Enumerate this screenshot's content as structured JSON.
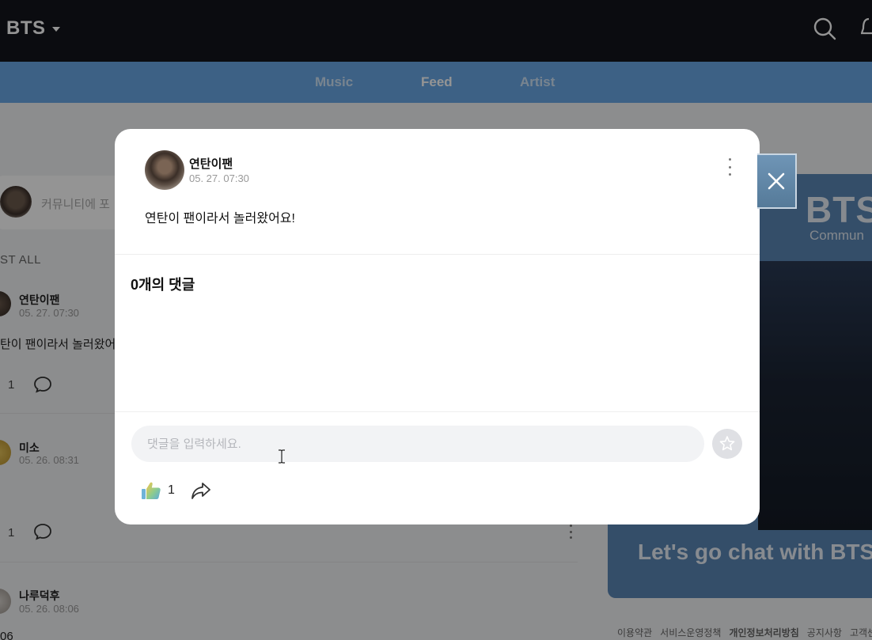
{
  "header": {
    "brand": "BTS"
  },
  "nav": {
    "tabs": [
      "Music",
      "Feed",
      "Artist"
    ],
    "active": "Feed"
  },
  "composer": {
    "placeholder": "커뮤니티에 포"
  },
  "list": {
    "header": "ST ALL"
  },
  "feed": [
    {
      "name": "연탄이팬",
      "time": "05. 27. 07:30",
      "body": "탄이 팬이라서 놀러왔어요",
      "likes": "1"
    },
    {
      "name": "미소",
      "time": "05. 26. 08:31",
      "likes": "1"
    },
    {
      "name": "나루덕후",
      "time": "05. 26. 08:06",
      "body": "06"
    }
  ],
  "side_banner": {
    "title": "BTS",
    "subtitle": "Commun",
    "cta": "Let's go chat with BTS"
  },
  "footer_links": [
    "이용약관",
    "서비스운영정책",
    "개인정보처리방침",
    "공지사항",
    "고객센"
  ],
  "modal": {
    "author": "연탄이팬",
    "time": "05. 27. 07:30",
    "body": "연탄이 팬이라서 놀러왔어요!",
    "comments_title": "0개의 댓글",
    "comment_placeholder": "댓글을 입력하세요.",
    "like_count": "1"
  },
  "colors": {
    "accent": "#6aa8e6",
    "topbar": "#14161c",
    "banner": "#5b87b5"
  },
  "icons": [
    "search-icon",
    "bell-icon",
    "more-vertical-icon",
    "emoji-icon",
    "thumbs-up-icon",
    "share-icon",
    "close-icon",
    "comment-icon"
  ]
}
